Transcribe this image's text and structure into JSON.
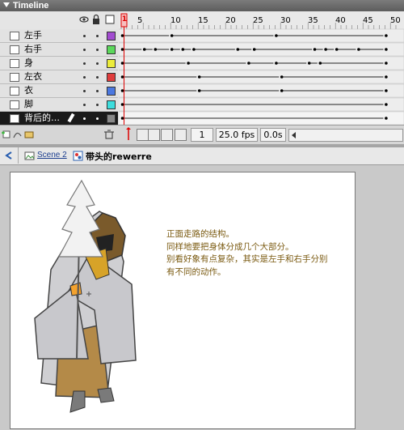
{
  "panel": {
    "title": "Timeline"
  },
  "layers": [
    {
      "name": "左手",
      "color": "#a24bd0",
      "selected": false
    },
    {
      "name": "右手",
      "color": "#5bd85b",
      "selected": false
    },
    {
      "name": "身",
      "color": "#ecec3a",
      "selected": false
    },
    {
      "name": "左衣",
      "color": "#e03c3c",
      "selected": false
    },
    {
      "name": "衣",
      "color": "#4b78e0",
      "selected": false
    },
    {
      "name": "脚",
      "color": "#3ddddd",
      "selected": false
    },
    {
      "name": "背后的…",
      "color": "#888888",
      "selected": true
    }
  ],
  "ruler": {
    "labels": [
      "1",
      "5",
      "10",
      "15",
      "20",
      "25",
      "30",
      "35",
      "40",
      "45",
      "50"
    ]
  },
  "status": {
    "current_frame": "1",
    "frame_rate": "25.0 fps",
    "elapsed_time": "0.0s"
  },
  "edit_bar": {
    "scene": "Scene 2",
    "symbol": "带头的rewerre"
  },
  "annotation": {
    "lines": [
      "正面走路的结构。",
      "同样地要把身体分成几个大部分。",
      "别看好象有点复杂，其实是左手和右手分别",
      "有不同的动作。"
    ]
  }
}
